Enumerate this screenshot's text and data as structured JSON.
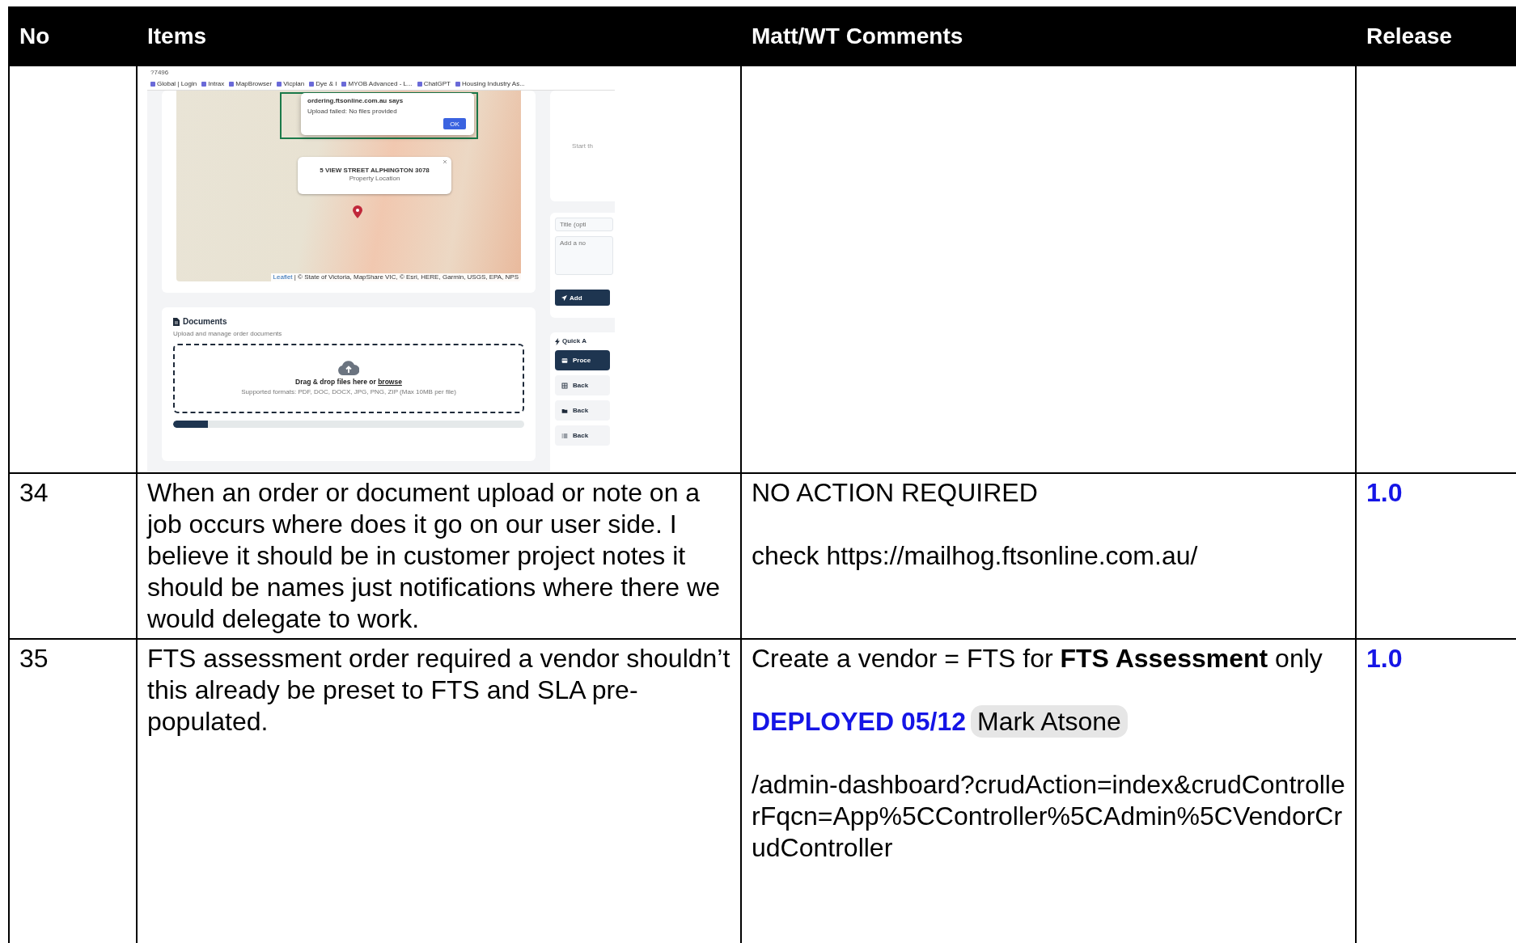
{
  "table": {
    "columns": [
      "No",
      "Items",
      "Matt/WT Comments",
      "Release"
    ],
    "rows": [
      {
        "items": {
          "kind": "screenshot",
          "screenshot": {
            "address": "?7496",
            "bookmarks": [
              "Global | Login",
              "Intrax",
              "MapBrowser",
              "Vicplan",
              "Dye & I",
              "MYOB Advanced - L...",
              "ChatGPT",
              "Housing Industry As..."
            ],
            "dialog": {
              "title": "ordering.ftsonline.com.au says",
              "message": "Upload failed: No files provided",
              "button": "OK"
            },
            "map_popup": {
              "title": "5 VIEW STREET ALPHINGTON 3078",
              "subtitle": "Property Location"
            },
            "attribution_link": "Leaflet",
            "attribution": "| © State of Victoria, MapShare VIC, © Esri, HERE, Garmin, USGS, EPA, NPS",
            "side_panel": {
              "hint": "Start th",
              "title_placeholder": "Title (opti",
              "note_placeholder": "Add a no",
              "button": "Add"
            },
            "documents": {
              "title": "Documents",
              "subtitle": "Upload and manage order documents",
              "drop_text": "Drag & drop files here or ",
              "drop_link": "browse",
              "formats": "Supported formats: PDF, DOC, DOCX, JPG, PNG, ZIP (Max 10MB per file)",
              "level": 0.1
            },
            "quick_actions": {
              "title": "Quick A",
              "buttons": [
                {
                  "label": "Proce",
                  "kind": "primary"
                },
                {
                  "label": "Back",
                  "kind": "secondary"
                },
                {
                  "label": "Back",
                  "kind": "secondary"
                },
                {
                  "label": "Back",
                  "kind": "secondary"
                }
              ]
            }
          }
        },
        "comments": []
      },
      {
        "no": "34",
        "items": {
          "kind": "text",
          "text": "When an order or document upload or note on a job occurs where does it go on our user side. I believe it should be in customer project notes it should be names just notifications where there we would delegate to work."
        },
        "comments": [
          {
            "kind": "text",
            "text": "NO ACTION REQUIRED"
          },
          {
            "kind": "text",
            "text": "check https://mailhog.ftsonline.com.au/"
          }
        ],
        "release": "1.0"
      },
      {
        "no": "35",
        "items": {
          "kind": "text",
          "text": "FTS assessment order required a vendor shouldn’t this already be preset to FTS and SLA pre-populated."
        },
        "comments": [
          {
            "kind": "text",
            "text": "Create a vendor = FTS for **FTS Assessment** only"
          },
          {
            "kind": "status",
            "status": "DEPLOYED 05/12",
            "person": "Mark Atsone"
          },
          {
            "kind": "url",
            "text": "/admin-dashboard?crudAction=index&crudControllerFqcn=App%5CController%5CAdmin%5CVendorCrudController"
          }
        ],
        "release": "1.0"
      }
    ]
  }
}
